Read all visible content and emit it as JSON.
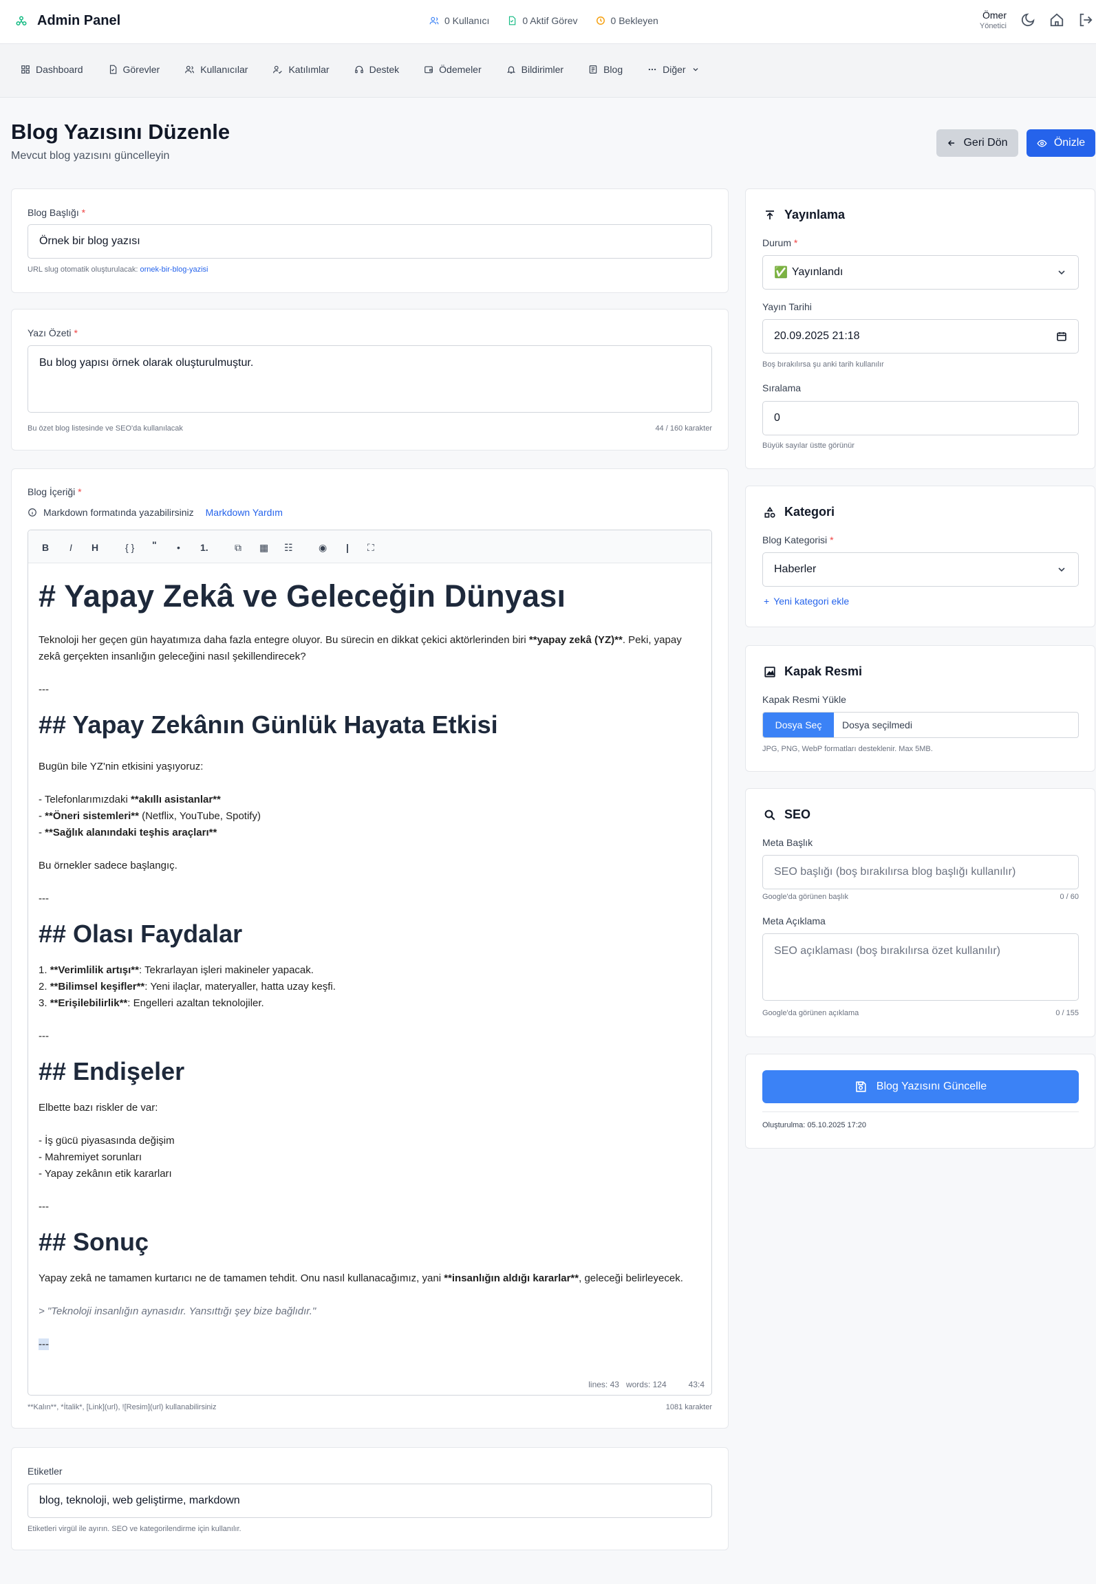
{
  "header": {
    "title": "Admin Panel",
    "stats": [
      {
        "label": "0 Kullanıcı",
        "color": "#3b82f6",
        "icon": "users-icon"
      },
      {
        "label": "0 Aktif Görev",
        "color": "#10b981",
        "icon": "document-icon"
      },
      {
        "label": "0 Bekleyen",
        "color": "#f59e0b",
        "icon": "clock-icon"
      }
    ],
    "user": {
      "name": "Ömer",
      "role": "Yönetici"
    }
  },
  "nav": [
    {
      "label": "Dashboard",
      "icon": "dashboard-icon"
    },
    {
      "label": "Görevler",
      "icon": "tasks-icon"
    },
    {
      "label": "Kullanıcılar",
      "icon": "users-icon"
    },
    {
      "label": "Katılımlar",
      "icon": "participations-icon"
    },
    {
      "label": "Destek",
      "icon": "headset-icon"
    },
    {
      "label": "Ödemeler",
      "icon": "wallet-icon"
    },
    {
      "label": "Bildirimler",
      "icon": "bell-icon"
    },
    {
      "label": "Blog",
      "icon": "blog-icon"
    },
    {
      "label": "Diğer",
      "icon": "more-icon"
    }
  ],
  "page": {
    "title": "Blog Yazısını Düzenle",
    "subtitle": "Mevcut blog yazısını güncelleyin",
    "back_label": "Geri Dön",
    "preview_label": "Önizle"
  },
  "form": {
    "title": {
      "label": "Blog Başlığı",
      "value": "Örnek bir blog yazısı",
      "slug_prefix": "URL slug otomatik oluşturulacak:",
      "slug": "ornek-bir-blog-yazisi"
    },
    "summary": {
      "label": "Yazı Özeti",
      "value": "Bu blog yapısı örnek olarak oluşturulmuştur.",
      "help": "Bu özet blog listesinde ve SEO'da kullanılacak",
      "count": "44 / 160 karakter"
    },
    "content": {
      "label": "Blog İçeriği",
      "info": "Markdown formatında yazabilirsiniz",
      "help_link": "Markdown Yardım",
      "toolbar": [
        "B",
        "I",
        "H",
        "{ }",
        "\"",
        "•",
        "1.",
        "⧉",
        "▦",
        "☷",
        "◉",
        "|",
        "⛶"
      ],
      "h1": "# Yapay Zekâ ve Geleceğin Dünyası",
      "p1_a": "Teknoloji her geçen gün hayatımıza daha fazla entegre oluyor. Bu sürecin en dikkat çekici aktörlerinden biri ",
      "p1_b": "**yapay zekâ (YZ)**",
      "p1_c": ". Peki, yapay zekâ gerçekten insanlığın geleceğini nasıl şekillendirecek?",
      "hr": "---",
      "h2_1": "## Yapay Zekânın Günlük Hayata Etkisi",
      "p2": "Bugün bile YZ'nin etkisini yaşıyoruz:",
      "li1_a": "- Telefonlarımızdaki ",
      "li1_b": "**akıllı asistanlar**",
      "li2_a": "- ",
      "li2_b": "**Öneri sistemleri**",
      "li2_c": " (Netflix, YouTube, Spotify)",
      "li3_a": "- ",
      "li3_b": "**Sağlık alanındaki teşhis araçları**",
      "p3": "Bu örnekler sadece başlangıç.",
      "h2_2": "## Olası Faydalar",
      "ol1_a": "1. ",
      "ol1_b": "**Verimlilik artışı**",
      "ol1_c": ": Tekrarlayan işleri makineler yapacak.",
      "ol2_a": "2. ",
      "ol2_b": "**Bilimsel keşifler**",
      "ol2_c": ": Yeni ilaçlar, materyaller, hatta uzay keşfi.",
      "ol3_a": "3. ",
      "ol3_b": "**Erişilebilirlik**",
      "ol3_c": ": Engelleri azaltan teknolojiler.",
      "h2_3": "## Endişeler",
      "p4": "Elbette bazı riskler de var:",
      "ul2_1": "- İş gücü piyasasında değişim",
      "ul2_2": "- Mahremiyet sorunları",
      "ul2_3": "- Yapay zekânın etik kararları",
      "h2_4": "## Sonuç",
      "p5_a": "Yapay zekâ ne tamamen kurtarıcı ne de tamamen tehdit. Onu nasıl kullanacağımız, yani ",
      "p5_b": "**insanlığın aldığı kararlar**",
      "p5_c": ", geleceği belirleyecek.",
      "quote": "> \"Teknoloji insanlığın aynasıdır. Yansıttığı şey bize bağlıdır.\"",
      "status_lines": "lines: 43",
      "status_words": "words: 124",
      "status_cursor": "43:4",
      "help": "**Kalın**, *İtalik*, [Link](url), ![Resim](url) kullanabilirsiniz",
      "count": "1081 karakter"
    },
    "tags": {
      "label": "Etiketler",
      "value": "blog, teknoloji, web geliştirme, markdown",
      "help": "Etiketleri virgül ile ayırın. SEO ve kategorilendirme için kullanılır."
    }
  },
  "sidebar": {
    "publish": {
      "title": "Yayınlama",
      "status_label": "Durum",
      "status_value": "Yayınlandı",
      "status_emoji": "✅",
      "date_label": "Yayın Tarihi",
      "date_value": "20.09.2025 21:18",
      "date_help": "Boş bırakılırsa şu anki tarih kullanılır",
      "order_label": "Sıralama",
      "order_value": "0",
      "order_help": "Büyük sayılar üstte görünür"
    },
    "category": {
      "title": "Kategori",
      "label": "Blog Kategorisi",
      "value": "Haberler",
      "add_link": "Yeni kategori ekle"
    },
    "cover": {
      "title": "Kapak Resmi",
      "label": "Kapak Resmi Yükle",
      "button": "Dosya Seç",
      "file_text": "Dosya seçilmedi",
      "help": "JPG, PNG, WebP formatları desteklenir. Max 5MB."
    },
    "seo": {
      "title": "SEO",
      "meta_title_label": "Meta Başlık",
      "meta_title_placeholder": "SEO başlığı (boş bırakılırsa blog başlığı kullanılır)",
      "meta_title_help": "Google'da görünen başlık",
      "meta_title_count": "0 / 60",
      "meta_desc_label": "Meta Açıklama",
      "meta_desc_placeholder": "SEO açıklaması (boş bırakılırsa özet kullanılır)",
      "meta_desc_help": "Google'da görünen açıklama",
      "meta_desc_count": "0 / 155"
    },
    "submit": {
      "label": "Blog Yazısını Güncelle",
      "created": "Oluşturulma: 05.10.2025 17:20"
    }
  },
  "colors": {
    "primary": "#2563eb",
    "button_blue": "#3b82f6",
    "required": "#ef4444"
  }
}
